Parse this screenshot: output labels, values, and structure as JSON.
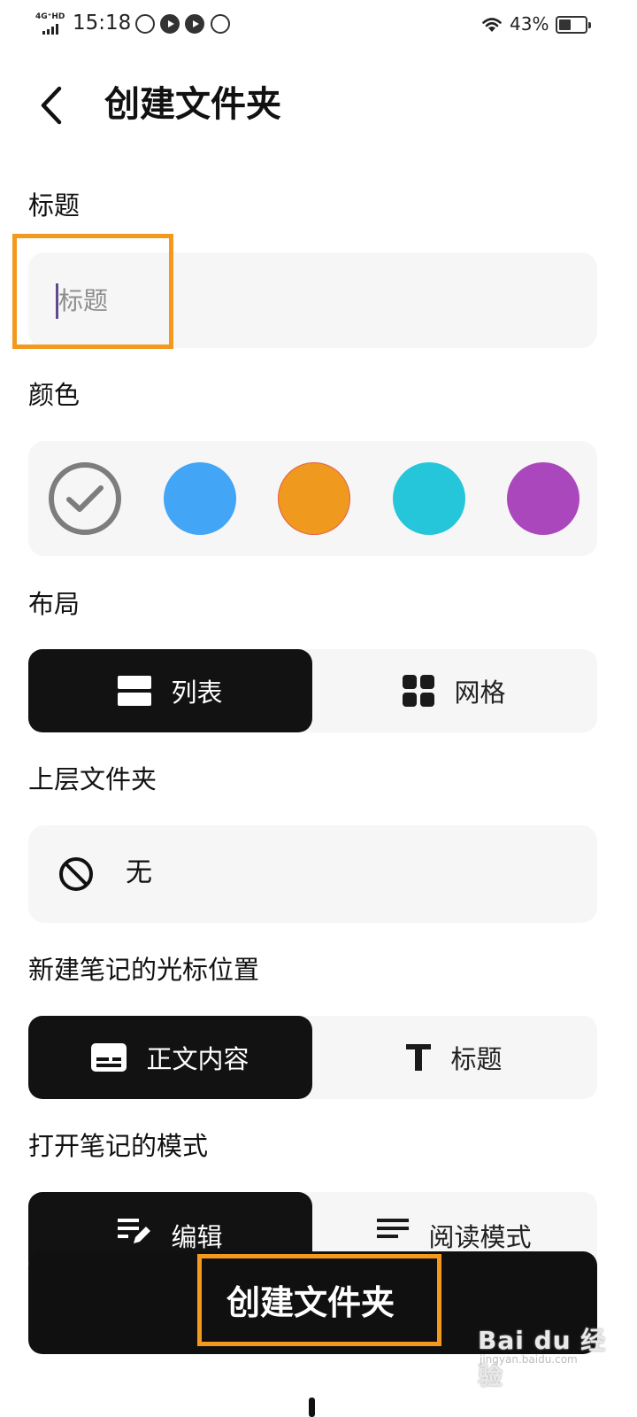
{
  "status_bar": {
    "network": "4G⁺HD",
    "time": "15:18",
    "battery": "43%"
  },
  "header": {
    "back_label": "back",
    "title": "创建文件夹"
  },
  "title_section": {
    "label": "标题",
    "placeholder": "标题",
    "value": ""
  },
  "color_section": {
    "label": "颜色",
    "swatches": [
      {
        "name": "grey",
        "color": "#ffffff",
        "selected": true
      },
      {
        "name": "blue",
        "color": "#42a5f5",
        "selected": false
      },
      {
        "name": "orange",
        "color": "#ef991f",
        "selected": false
      },
      {
        "name": "cyan",
        "color": "#26c6da",
        "selected": false
      },
      {
        "name": "purple",
        "color": "#ab47bc",
        "selected": false
      }
    ]
  },
  "layout_section": {
    "label": "布局",
    "options": [
      {
        "label": "列表",
        "icon": "list-layout-icon",
        "selected": true
      },
      {
        "label": "网格",
        "icon": "grid-layout-icon",
        "selected": false
      }
    ]
  },
  "parent_section": {
    "label": "上层文件夹",
    "value": "无",
    "icon": "no-entry-icon"
  },
  "cursor_section": {
    "label": "新建笔记的光标位置",
    "options": [
      {
        "label": "正文内容",
        "icon": "body-text-icon",
        "selected": true
      },
      {
        "label": "标题",
        "icon": "title-t-icon",
        "selected": false
      }
    ]
  },
  "open_mode_section": {
    "label": "打开笔记的模式",
    "options": [
      {
        "label": "编辑",
        "icon": "edit-icon",
        "selected": true
      },
      {
        "label": "阅读模式",
        "icon": "read-mode-icon",
        "selected": false
      }
    ]
  },
  "create_button": {
    "label": "创建文件夹"
  },
  "watermark": {
    "text": "Bai du 经验",
    "sub": "jingyan.baidu.com"
  },
  "colors": {
    "highlight": "#f39a1e",
    "active_segment": "#121212",
    "panel": "#f6f6f6"
  }
}
